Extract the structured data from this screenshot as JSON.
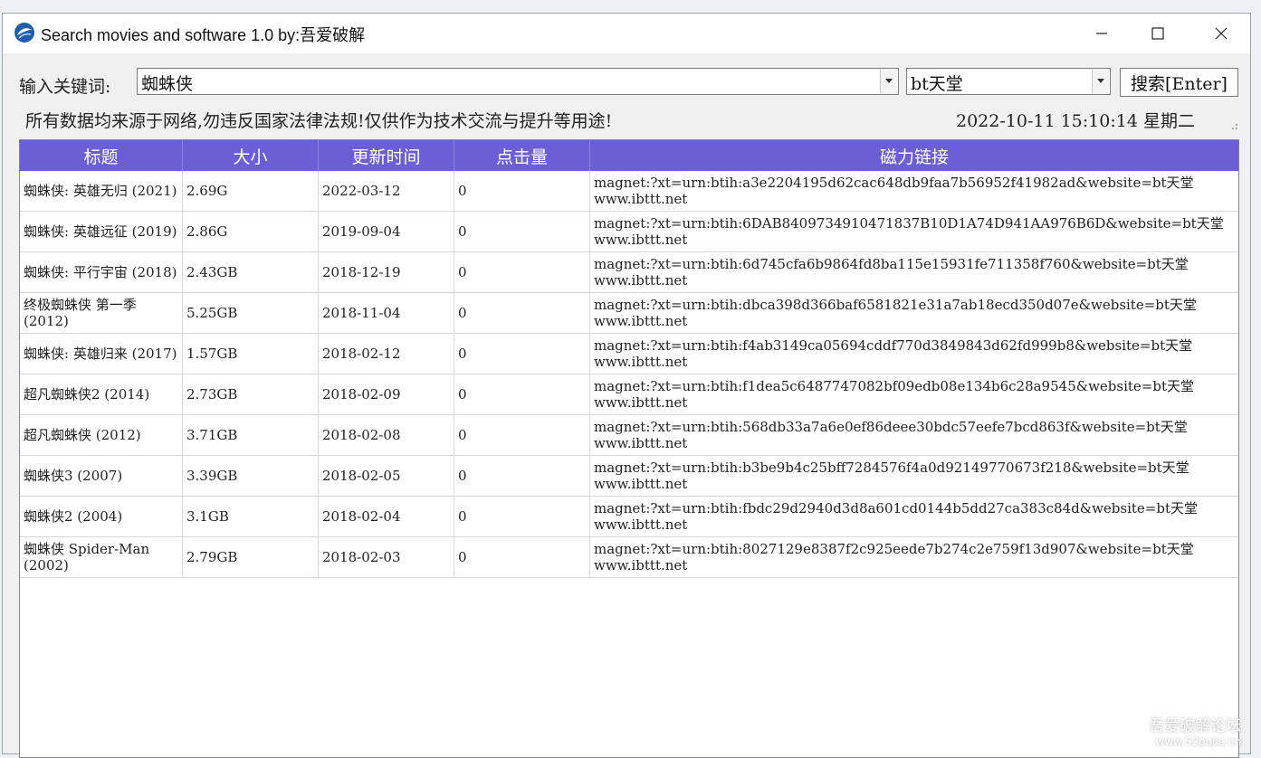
{
  "window": {
    "title": "Search movies and software 1.0 by:吾爱破解"
  },
  "search": {
    "label": "输入关键词:",
    "keyword": "蜘蛛侠",
    "source": "bt天堂",
    "button_label": "搜索[Enter]"
  },
  "notice": "所有数据均来源于网络,勿违反国家法律法规!仅供作为技术交流与提升等用途!",
  "clock": "2022-10-11  15:10:14  星期二",
  "table": {
    "headers": [
      "标题",
      "大小",
      "更新时间",
      "点击量",
      "磁力链接"
    ],
    "rows": [
      {
        "title": "蜘蛛侠: 英雄无归 (2021)",
        "size": "2.69G",
        "date": "2022-03-12",
        "clicks": "0",
        "magnet": "magnet:?xt=urn:btih:a3e2204195d62cac648db9faa7b56952f41982ad&website=bt天堂",
        "site": "www.ibttt.net"
      },
      {
        "title": "蜘蛛侠: 英雄远征 (2019)",
        "size": "2.86G",
        "date": "2019-09-04",
        "clicks": "0",
        "magnet": "magnet:?xt=urn:btih:6DAB8409734910471837B10D1A74D941AA976B6D&website=bt天堂",
        "site": "www.ibttt.net"
      },
      {
        "title": "蜘蛛侠: 平行宇宙 (2018)",
        "size": "2.43GB",
        "date": "2018-12-19",
        "clicks": "0",
        "magnet": "magnet:?xt=urn:btih:6d745cfa6b9864fd8ba115e15931fe711358f760&website=bt天堂",
        "site": "www.ibttt.net"
      },
      {
        "title": "终极蜘蛛侠 第一季 (2012)",
        "size": "5.25GB",
        "date": "2018-11-04",
        "clicks": "0",
        "magnet": "magnet:?xt=urn:btih:dbca398d366baf6581821e31a7ab18ecd350d07e&website=bt天堂",
        "site": "www.ibttt.net"
      },
      {
        "title": "蜘蛛侠: 英雄归来 (2017)",
        "size": "1.57GB",
        "date": "2018-02-12",
        "clicks": "0",
        "magnet": "magnet:?xt=urn:btih:f4ab3149ca05694cddf770d3849843d62fd999b8&website=bt天堂",
        "site": "www.ibttt.net"
      },
      {
        "title": "超凡蜘蛛侠2 (2014)",
        "size": "2.73GB",
        "date": "2018-02-09",
        "clicks": "0",
        "magnet": "magnet:?xt=urn:btih:f1dea5c6487747082bf09edb08e134b6c28a9545&website=bt天堂",
        "site": "www.ibttt.net"
      },
      {
        "title": "超凡蜘蛛侠 (2012)",
        "size": "3.71GB",
        "date": "2018-02-08",
        "clicks": "0",
        "magnet": "magnet:?xt=urn:btih:568db33a7a6e0ef86deee30bdc57eefe7bcd863f&website=bt天堂",
        "site": "www.ibttt.net"
      },
      {
        "title": "蜘蛛侠3 (2007)",
        "size": "3.39GB",
        "date": "2018-02-05",
        "clicks": "0",
        "magnet": "magnet:?xt=urn:btih:b3be9b4c25bff7284576f4a0d92149770673f218&website=bt天堂",
        "site": "www.ibttt.net"
      },
      {
        "title": "蜘蛛侠2 (2004)",
        "size": "3.1GB",
        "date": "2018-02-04",
        "clicks": "0",
        "magnet": "magnet:?xt=urn:btih:fbdc29d2940d3d8a601cd0144b5dd27ca383c84d&website=bt天堂",
        "site": "www.ibttt.net"
      },
      {
        "title": "蜘蛛侠 Spider-Man (2002)",
        "size": "2.79GB",
        "date": "2018-02-03",
        "clicks": "0",
        "magnet": "magnet:?xt=urn:btih:8027129e8387f2c925eede7b274c2e759f13d907&website=bt天堂",
        "site": "www.ibttt.net"
      }
    ]
  },
  "watermark": {
    "line1": "吾爱破解论坛",
    "line2": "www.52pojie.cn"
  },
  "colors": {
    "header_bg": "#6b5fd6",
    "header_text": "#ffffff",
    "window_bg": "#f0f0f0"
  },
  "icons": {
    "app": "app-logo-icon",
    "minimize": "minimize-icon",
    "maximize": "maximize-icon",
    "close": "close-icon",
    "dropdown": "chevron-down-icon"
  }
}
